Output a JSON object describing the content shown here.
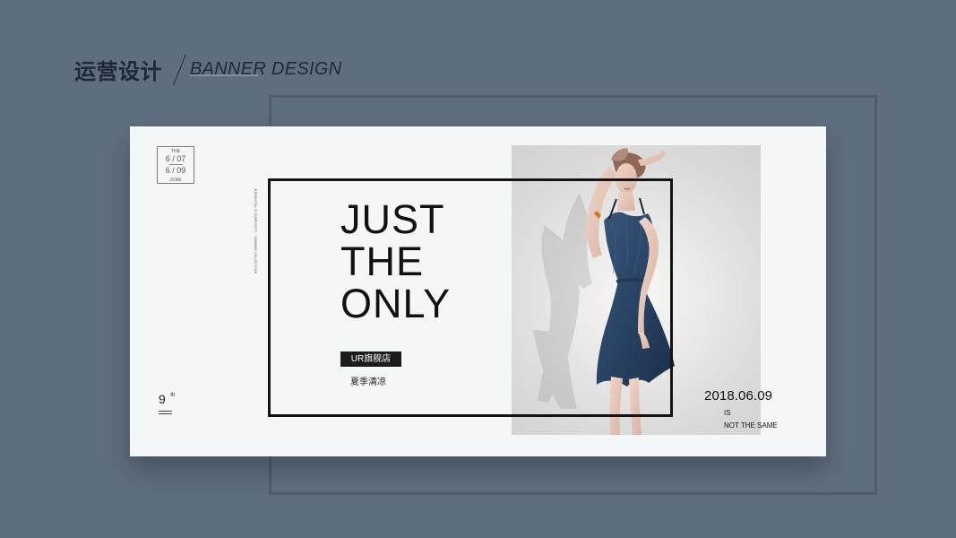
{
  "header": {
    "title_cn": "运营设计",
    "title_en": "BANNER DESIGN"
  },
  "banner": {
    "date_badge": {
      "top_label": "THE",
      "date_start": "6 / 07",
      "date_end": "6 / 09",
      "bottom_label": "JUNE"
    },
    "vertical_text": "ESSENTIAL IS SIMPLICITY · SUMMER COLLECTION",
    "ninth": {
      "number": "9",
      "suffix": "th"
    },
    "headline": {
      "line1": "JUST",
      "line2": "THE",
      "line3": "ONLY"
    },
    "store_label": "UR旗舰店",
    "season_text": "夏季清凉",
    "photo_label": "model-photo",
    "date_main": "2018.06.09",
    "is_text": "IS",
    "not_same_text": "NOT THE SAME"
  }
}
